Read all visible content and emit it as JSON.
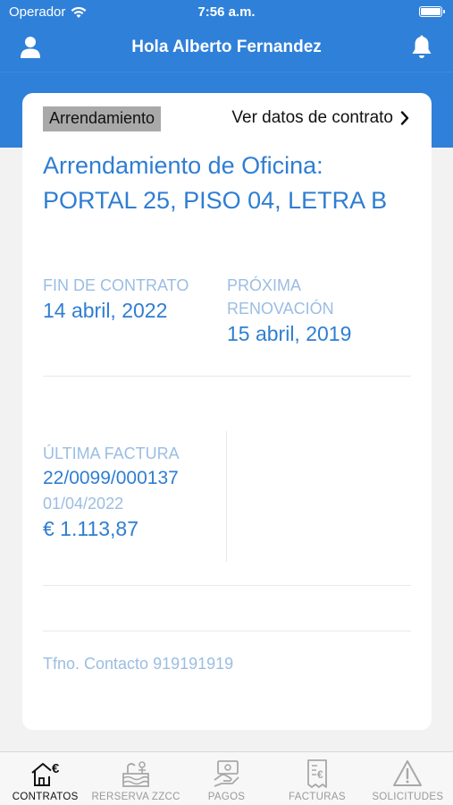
{
  "status_bar": {
    "carrier": "Operador",
    "time": "7:56 a.m."
  },
  "header": {
    "title": "Hola Alberto Fernandez"
  },
  "contract": {
    "tag": "Arrendamiento",
    "view_link": "Ver datos de contrato",
    "title": "Arrendamiento de Oficina: PORTAL 25, PISO 04, LETRA B",
    "end_label": "FIN DE CONTRATO",
    "end_value": "14 abril, 2022",
    "renewal_label": "PRÓXIMA RENOVACIÓN",
    "renewal_value": "15 abril, 2019",
    "invoice_label": "ÚLTIMA FACTURA",
    "invoice_number": "22/0099/000137",
    "invoice_date": "01/04/2022",
    "invoice_amount": "€ 1.113,87",
    "phone": "Tfno. Contacto 919191919"
  },
  "tabs": [
    {
      "label": "CONTRATOS",
      "icon": "house-euro-icon",
      "active": true
    },
    {
      "label": "RERSERVA ZZCC",
      "icon": "amenities-icon",
      "active": false
    },
    {
      "label": "PAGOS",
      "icon": "payment-icon",
      "active": false
    },
    {
      "label": "FACTURAS",
      "icon": "invoice-icon",
      "active": false
    },
    {
      "label": "SOLICITUDES",
      "icon": "warning-icon",
      "active": false
    }
  ],
  "colors": {
    "primary": "#2f80d9",
    "text_blue": "#2f7ed2",
    "label_blue": "#9bbde3"
  }
}
